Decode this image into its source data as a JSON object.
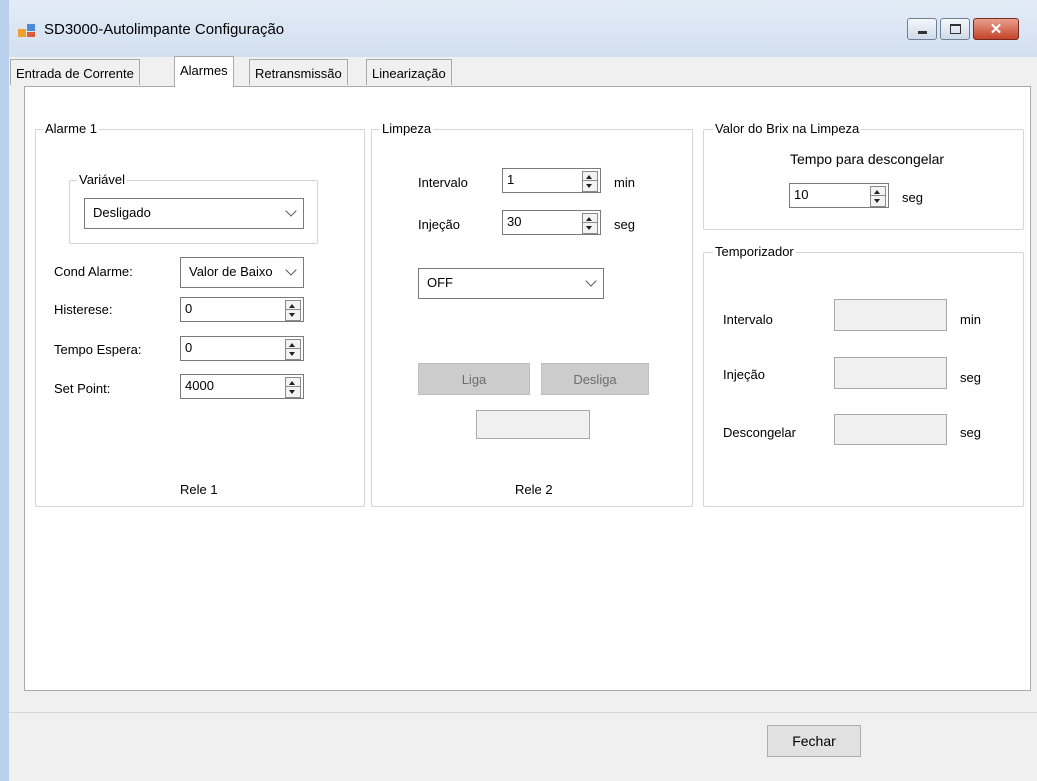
{
  "window": {
    "title": "SD3000-Autolimpante Configuração"
  },
  "tabs": [
    {
      "label": "Entrada de Corrente"
    },
    {
      "label": "Alarmes"
    },
    {
      "label": "Retransmissão"
    },
    {
      "label": "Linearização"
    }
  ],
  "alarme1": {
    "group_label": "Alarme 1",
    "variavel_label": "Variável",
    "variavel_value": "Desligado",
    "cond_alarme_label": "Cond Alarme:",
    "cond_alarme_value": "Valor de Baixo",
    "histerese_label": "Histerese:",
    "histerese_value": "0",
    "tempo_espera_label": "Tempo Espera:",
    "tempo_espera_value": "0",
    "set_point_label": "Set Point:",
    "set_point_value": "4000",
    "footer": "Rele 1"
  },
  "limpeza": {
    "group_label": "Limpeza",
    "intervalo_label": "Intervalo",
    "intervalo_value": "1",
    "intervalo_unit": "min",
    "injecao_label": "Injeção",
    "injecao_value": "30",
    "injecao_unit": "seg",
    "mode_value": "OFF",
    "liga_label": "Liga",
    "desliga_label": "Desliga",
    "status_value": "",
    "footer": "Rele 2"
  },
  "brix": {
    "group_label": "Valor do Brix na Limpeza",
    "tempo_label": "Tempo para descongelar",
    "tempo_value": "10",
    "tempo_unit": "seg"
  },
  "temporizador": {
    "group_label": "Temporizador",
    "intervalo_label": "Intervalo",
    "intervalo_unit": "min",
    "injecao_label": "Injeção",
    "injecao_unit": "seg",
    "descongelar_label": "Descongelar",
    "descongelar_unit": "seg"
  },
  "footer": {
    "close_label": "Fechar"
  }
}
